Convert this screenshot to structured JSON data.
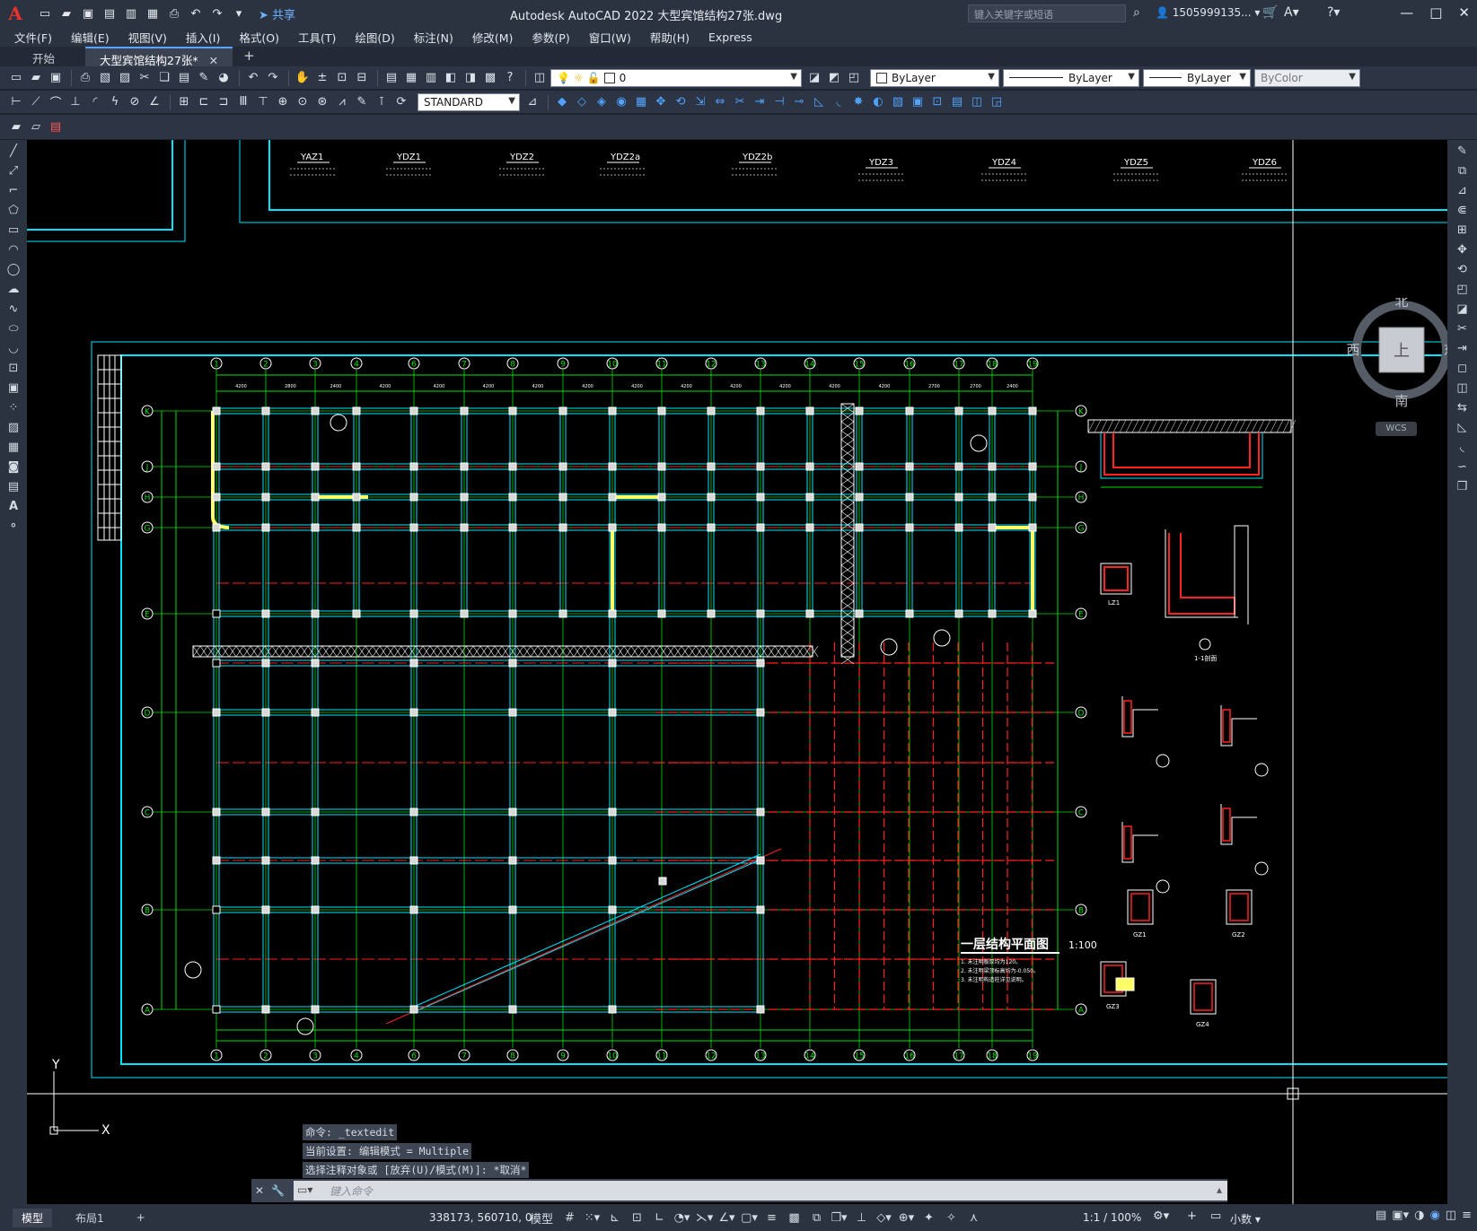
{
  "app": {
    "logo": "A",
    "title": "Autodesk AutoCAD 2022    大型宾馆结构27张.dwg",
    "share_label": "共享",
    "search_placeholder": "键入关键字或短语",
    "user": "1505999135... ▾"
  },
  "menu": [
    "文件(F)",
    "编辑(E)",
    "视图(V)",
    "插入(I)",
    "格式(O)",
    "工具(T)",
    "绘图(D)",
    "标注(N)",
    "修改(M)",
    "参数(P)",
    "窗口(W)",
    "帮助(H)",
    "Express"
  ],
  "tabs": {
    "start": "开始",
    "active": "大型宾馆结构27张*"
  },
  "toolbar": {
    "layer": "0",
    "text_style": "STANDARD",
    "color": "ByLayer",
    "linetype": "ByLayer",
    "lineweight": "ByLayer",
    "plotstyle": "ByColor"
  },
  "viewcube": {
    "north": "北",
    "south": "南",
    "east": "东",
    "west": "西",
    "top": "上",
    "wcs": "WCS"
  },
  "drawing": {
    "title": "一层结构平面图",
    "scale": "1:100",
    "column_labels": [
      "YAZ1",
      "YDZ1",
      "YDZ2",
      "YDZ2a",
      "YDZ2b",
      "YDZ3",
      "YDZ4",
      "YDZ5",
      "YDZ6"
    ],
    "grid_numbers": [
      "1",
      "2",
      "3",
      "4",
      "6",
      "7",
      "8",
      "9",
      "10",
      "11",
      "12",
      "13",
      "14",
      "15",
      "16",
      "17",
      "18",
      "19"
    ],
    "grid_letters": [
      "K",
      "J",
      "H",
      "G",
      "E",
      "D",
      "C",
      "B",
      "A"
    ],
    "notes": [
      "1. 未注明板厚均为120。",
      "2. 未注明梁顶标高均为-0.050。",
      "3. 未注明构造柱详见说明。"
    ],
    "section_labels": [
      "1-1剖面",
      "LZ1",
      "GZ1",
      "GZ2",
      "GZ3",
      "GZ4"
    ],
    "ucs_x": "X",
    "ucs_y": "Y"
  },
  "command": {
    "history": [
      "命令: _textedit",
      "当前设置: 编辑模式 = Multiple",
      "选择注释对象或 [放弃(U)/模式(M)]: *取消*"
    ],
    "placeholder": "键入命令"
  },
  "status": {
    "model_tab": "模型",
    "layout_tab": "布局1",
    "coords": "338173, 560710, 0",
    "space": "模型",
    "scale": "1:1 / 100%",
    "units": "小数"
  },
  "colors": {
    "bg": "#000000",
    "grid_green": "#00e000",
    "cyan": "#00e5ff",
    "red": "#ff2020",
    "yellow": "#ffff66",
    "white": "#ffffff"
  }
}
